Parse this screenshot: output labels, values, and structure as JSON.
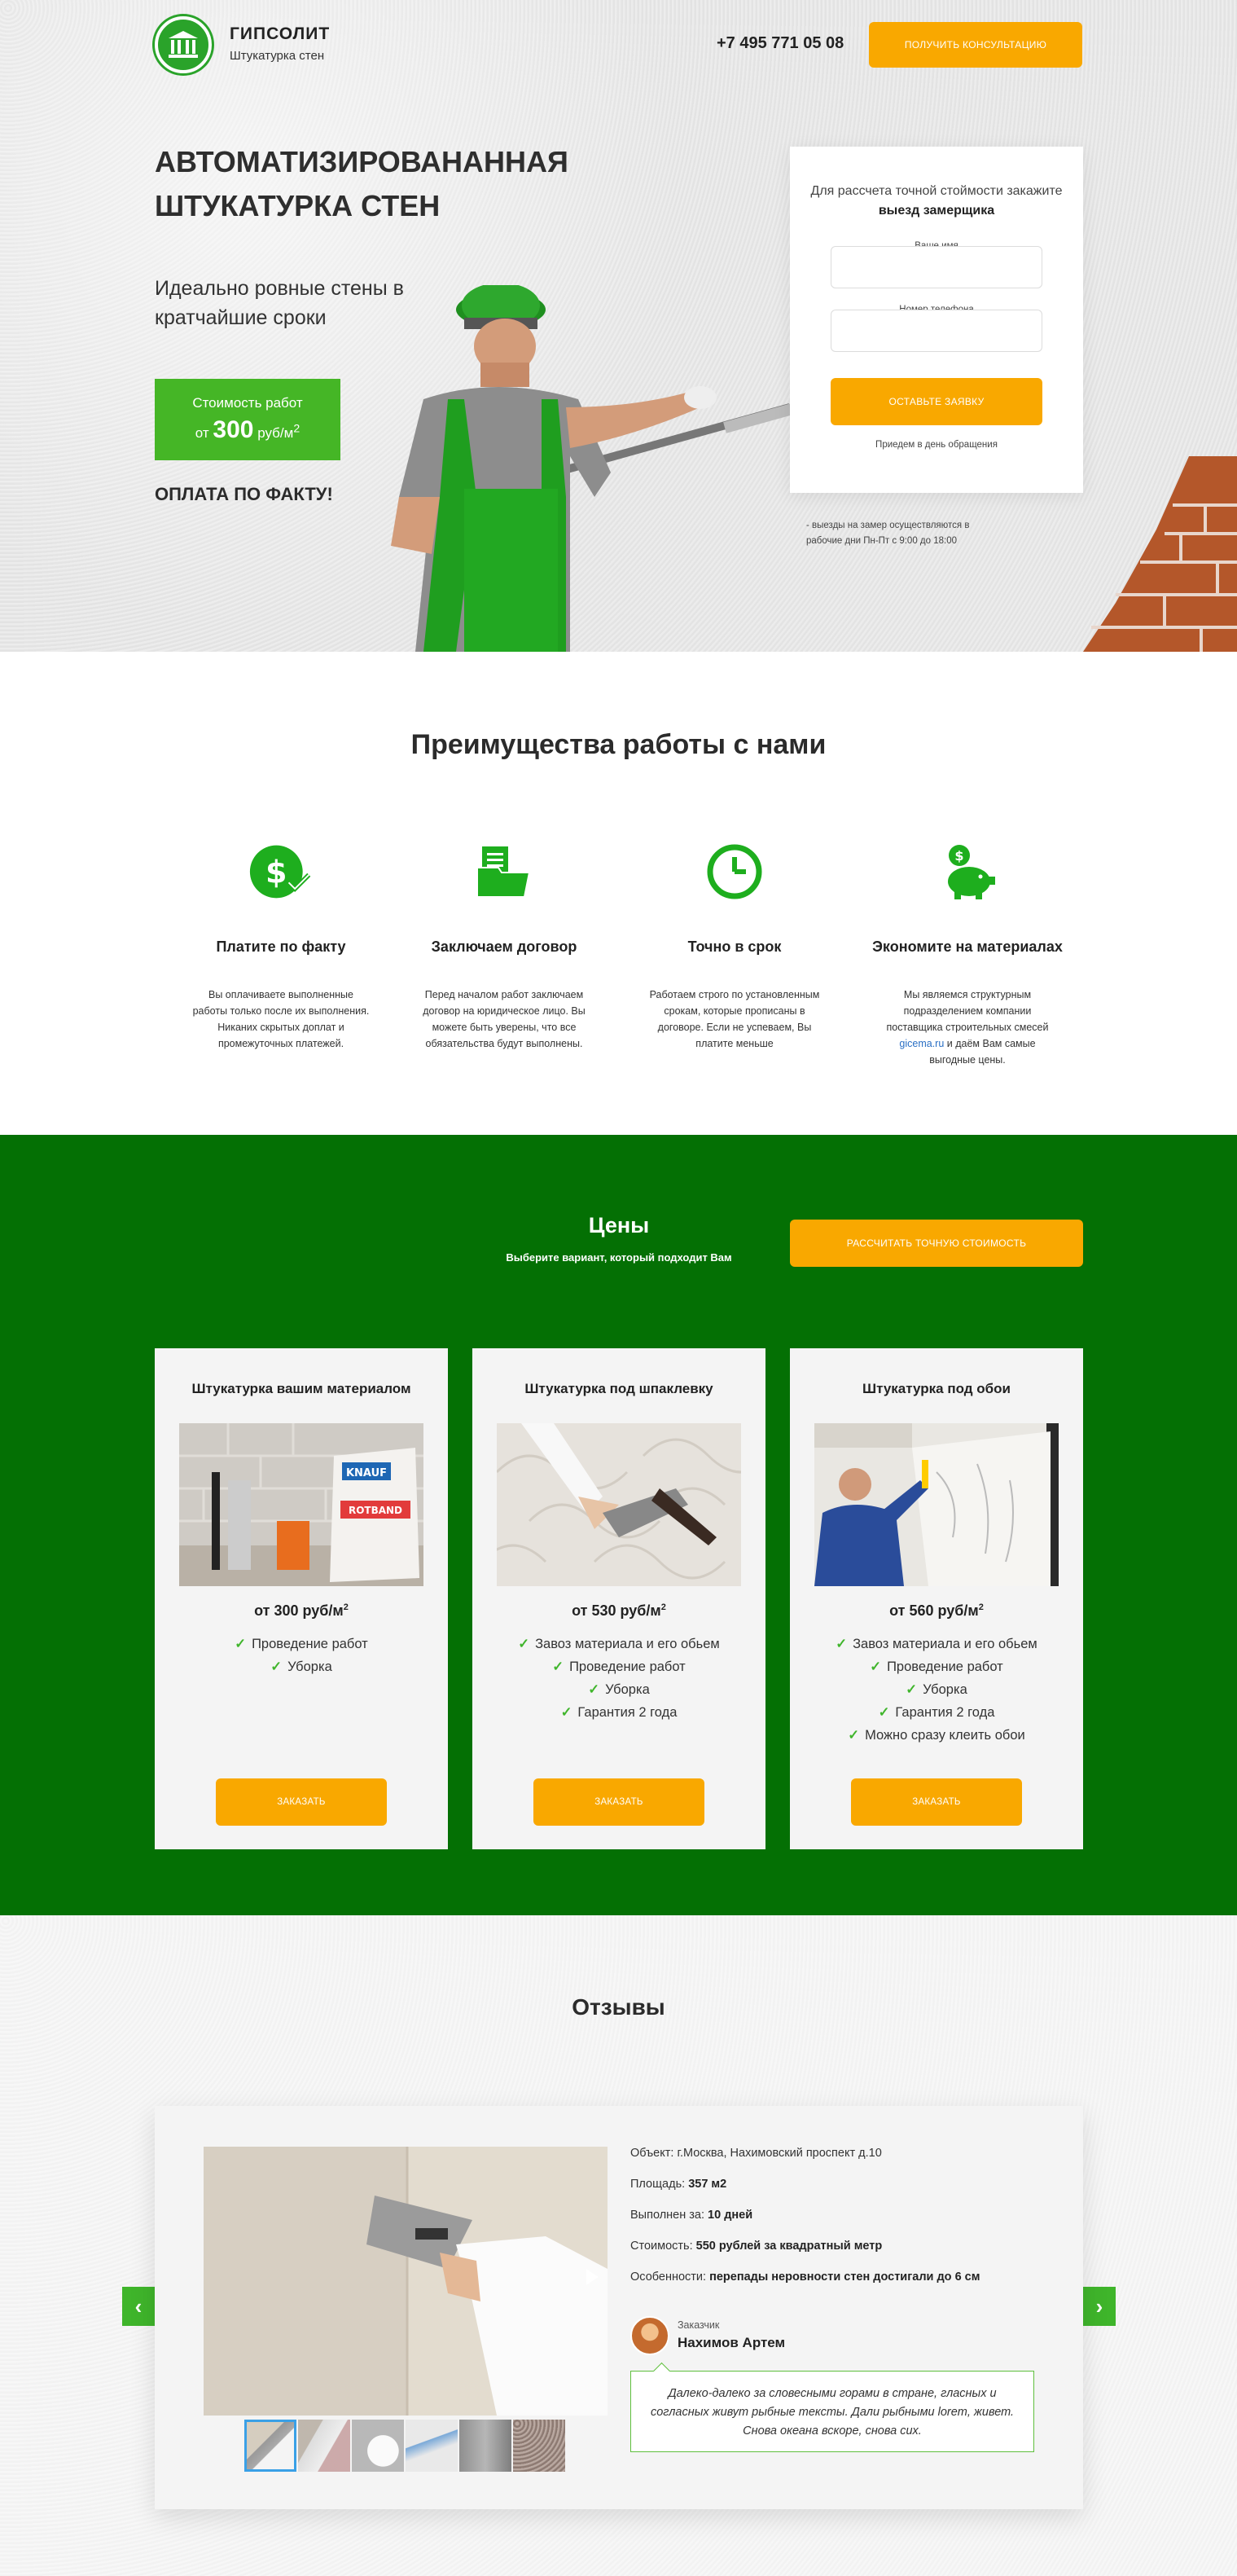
{
  "header": {
    "brand": "ГИПСОЛИТ",
    "tagline": "Штукатурка стен",
    "phone": "+7 495 771 05 08",
    "cta": "ПОЛУЧИТЬ КОНСУЛЬТАЦИЮ"
  },
  "hero": {
    "title": "АВТОМАТИЗИРОВАНАННАЯ ШТУКАТУРКА СТЕН",
    "subtitle": "Идеально ровные стены в кратчайшие сроки",
    "price_label": "Стоимость работ",
    "price_prefix": "от",
    "price_value": "300",
    "price_unit": "руб/м",
    "price_unit_sup": "2",
    "pay_note": "ОПЛАТА ПО ФАКТУ!"
  },
  "form": {
    "intro": "Для рассчета точной стоймости закажите",
    "intro_bold": "выезд замерщика",
    "name_label": "Ваше имя",
    "phone_label": "Номер телефона",
    "submit": "ОСТАВЬТЕ ЗАЯВКУ",
    "note": "Приедем в день обращения",
    "schedule": "- выезды на замер осуществляются в рабочие дни Пн-Пт с 9:00 до 18:00"
  },
  "advantages": {
    "title": "Преимущества работы с нами",
    "items": [
      {
        "icon": "dollar-check-icon",
        "title": "Платите по факту",
        "text": "Вы оплачиваете выполненные работы только после их выполнения.\nНиканих скрытых доплат и промежуточных платежей."
      },
      {
        "icon": "documents-folder-icon",
        "title": "Заключаем договор",
        "text": "Перед началом работ заключаем договор на юридическое лицо. Вы можете быть уверены, что все обязательства будут выполнены."
      },
      {
        "icon": "clock-icon",
        "title": "Точно в срок",
        "text": "Работаем строго по установленным срокам, которые прописаны в договоре. Если не успеваем, Вы платите меньше"
      },
      {
        "icon": "piggy-bank-icon",
        "title": "Экономите на материалах",
        "text_before": "Мы являемся структурным подразделением компании поставщика строительных смесей",
        "link": "gicema.ru",
        "text_after": "и даём Вам самые выгодные цены."
      }
    ]
  },
  "prices": {
    "title": "Цены",
    "subtitle": "Выберите вариант, который подходит Вам",
    "cta": "РАССЧИТАТЬ ТОЧНУЮ СТОИМОСТЬ",
    "cards": [
      {
        "title": "Штукатурка вашим материалом",
        "price": "от 300 руб/м",
        "sup": "2",
        "features": [
          "Проведение работ",
          "Уборка"
        ],
        "button": "ЗАКАЗАТЬ"
      },
      {
        "title": "Штукатурка под шпаклевку",
        "price": "от 530 руб/м",
        "sup": "2",
        "features": [
          "Завоз материала и его обьем",
          "Проведение работ",
          "Уборка",
          "Гарантия 2 года"
        ],
        "button": "ЗАКАЗАТЬ"
      },
      {
        "title": "Штукатурка под обои",
        "price": "от 560 руб/м",
        "sup": "2",
        "features": [
          "Завоз материала и его обьем",
          "Проведение работ",
          "Уборка",
          "Гарантия 2 года",
          "Можно сразу клеить обои"
        ],
        "button": "ЗАКАЗАТЬ"
      }
    ],
    "bag_brand": "KNAUF",
    "bag_product": "ROTBAND"
  },
  "reviews": {
    "title": "Отзывы",
    "object_label": "Объект:",
    "object_value": "г.Москва, Нахимовский проспект д.10",
    "area_label": "Площадь:",
    "area_value": "357 м2",
    "time_label": "Выполнен за:",
    "time_value": "10 дней",
    "cost_label": "Стоимость:",
    "cost_value": "550 рублей за квадратный метр",
    "feature_label": "Особенности:",
    "feature_value": "перепады неровности стен достигали до 6 см",
    "customer_label": "Заказчик",
    "customer_name": "Нахимов Артем",
    "quote": "Далеко-далеко за словесными горами в стране, гласных и согласных живут рыбные тексты. Дали рыбными lorem, живет. Снова океана вскоре, снова сих."
  },
  "colors": {
    "accent_orange": "#f9a800",
    "green_dark": "#047004",
    "green_bright": "#45b626"
  }
}
